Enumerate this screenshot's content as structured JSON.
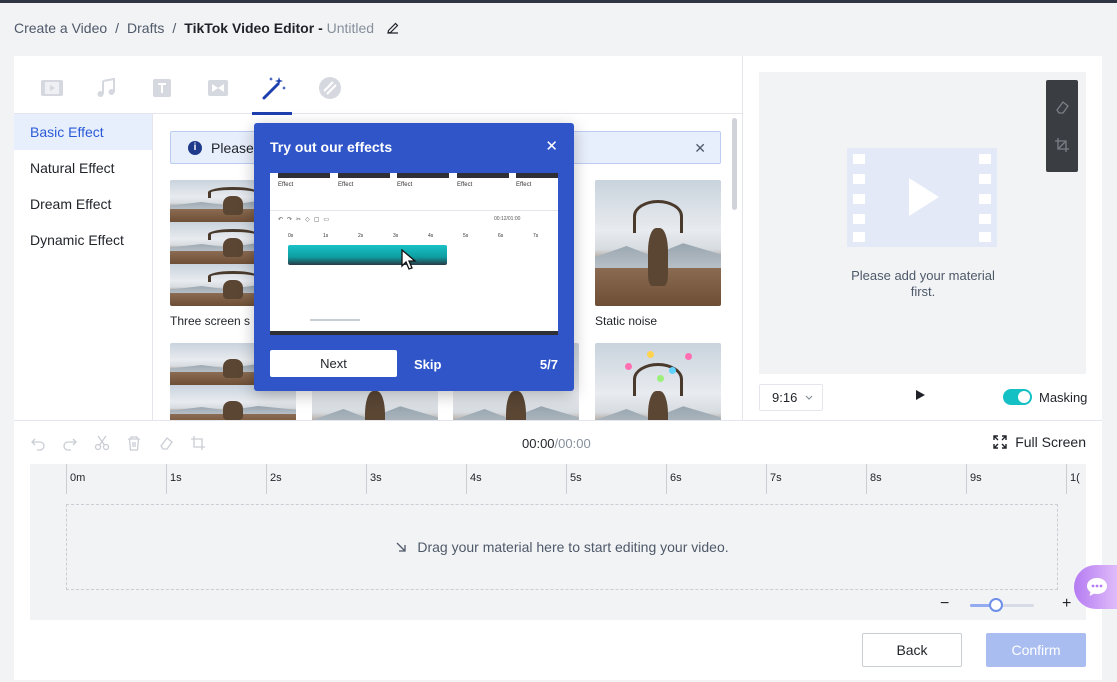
{
  "breadcrumb": {
    "item1": "Create a Video",
    "sep": "/",
    "item2": "Drafts",
    "current": "TikTok Video Editor -",
    "untitled": "Untitled"
  },
  "library": {
    "tabs": [
      {
        "name": "video-tab",
        "icon": "film-icon"
      },
      {
        "name": "music-tab",
        "icon": "music-note-icon"
      },
      {
        "name": "text-tab",
        "icon": "text-icon"
      },
      {
        "name": "transition-tab",
        "icon": "transition-icon"
      },
      {
        "name": "effects-tab",
        "icon": "magic-wand-icon",
        "active": true
      },
      {
        "name": "sticker-tab",
        "icon": "sticker-icon"
      }
    ],
    "categories": [
      "Basic Effect",
      "Natural Effect",
      "Dream Effect",
      "Dynamic Effect"
    ],
    "active_category": "Basic Effect",
    "info_text": "Please",
    "info_tail": ".",
    "effects": [
      {
        "name": "Three screen s"
      },
      {
        "name": "Static noise"
      }
    ]
  },
  "preview": {
    "placeholder": "Please add your material first.",
    "ratio": "9:16",
    "masking_label": "Masking",
    "masking_on": true
  },
  "timeline": {
    "current_time": "00:00",
    "total_time": "/00:00",
    "fullscreen_label": "Full Screen",
    "ruler": [
      "0m",
      "1s",
      "2s",
      "3s",
      "4s",
      "5s",
      "6s",
      "7s",
      "8s",
      "9s",
      "1("
    ],
    "drop_text": "Drag your material here to start editing your video.",
    "zoom_level": 0.4
  },
  "actions": {
    "back": "Back",
    "confirm": "Confirm"
  },
  "tour": {
    "title": "Try out our effects",
    "next": "Next",
    "skip": "Skip",
    "step": "5/7",
    "shot": {
      "effect_labels": [
        "Effect",
        "Effect",
        "Effect",
        "Effect",
        "Effect"
      ],
      "timecode": "00:12/01:00",
      "ruler": [
        "0s",
        "1s",
        "2s",
        "3s",
        "4s",
        "5s",
        "6s",
        "7s"
      ]
    }
  },
  "colors": {
    "accent": "#2f55c9",
    "active_tab": "#1e40af",
    "toggle": "#14c0c4",
    "confirm_disabled": "#a9bdf0"
  }
}
